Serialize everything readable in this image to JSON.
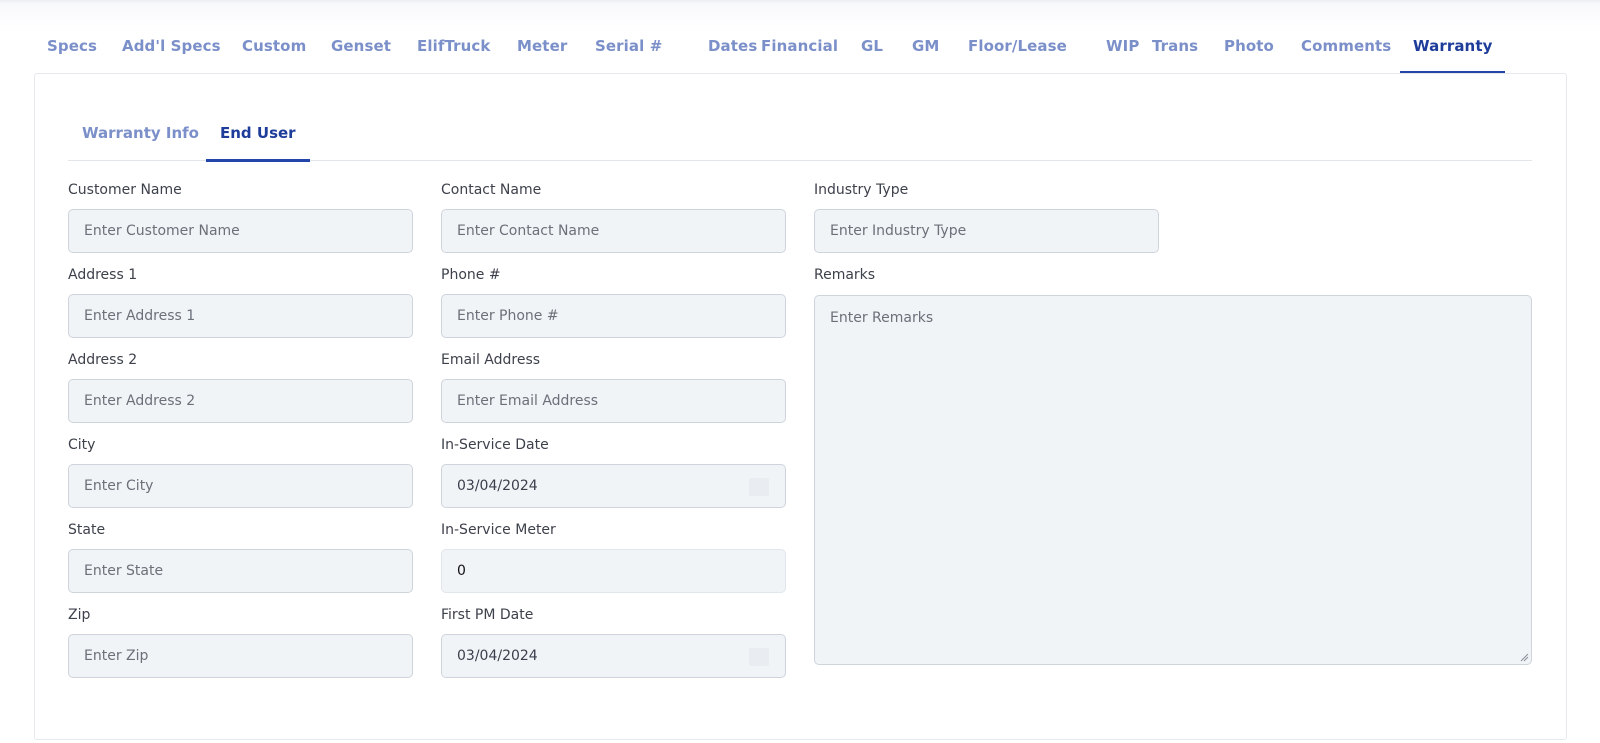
{
  "top_tabs": [
    {
      "label": "Specs"
    },
    {
      "label": "Add'l Specs"
    },
    {
      "label": "Custom"
    },
    {
      "label": "Genset"
    },
    {
      "label": "ElifTruck"
    },
    {
      "label": "Meter"
    },
    {
      "label": "Serial #"
    },
    {
      "label": "Dates"
    },
    {
      "label": "Financial"
    },
    {
      "label": "GL"
    },
    {
      "label": "GM"
    },
    {
      "label": "Floor/Lease"
    },
    {
      "label": "WIP"
    },
    {
      "label": "Trans"
    },
    {
      "label": "Photo"
    },
    {
      "label": "Comments"
    },
    {
      "label": "Warranty"
    }
  ],
  "active_top_tab": "Warranty",
  "sub_tabs": [
    {
      "label": "Warranty Info"
    },
    {
      "label": "End User"
    }
  ],
  "active_sub_tab": "End User",
  "form": {
    "customer_name": {
      "label": "Customer Name",
      "placeholder": "Enter Customer Name"
    },
    "address1": {
      "label": "Address 1",
      "placeholder": "Enter Address 1"
    },
    "address2": {
      "label": "Address 2",
      "placeholder": "Enter Address 2"
    },
    "city": {
      "label": "City",
      "placeholder": "Enter City"
    },
    "state": {
      "label": "State",
      "placeholder": "Enter State"
    },
    "zip": {
      "label": "Zip",
      "placeholder": "Enter Zip"
    },
    "contact_name": {
      "label": "Contact Name",
      "placeholder": "Enter Contact Name"
    },
    "phone": {
      "label": "Phone #",
      "placeholder": "Enter Phone #"
    },
    "email": {
      "label": "Email Address",
      "placeholder": "Enter Email Address"
    },
    "in_service_date": {
      "label": "In-Service Date",
      "value": "03/04/2024"
    },
    "in_service_meter": {
      "label": "In-Service Meter",
      "value": "0"
    },
    "first_pm_date": {
      "label": "First PM Date",
      "value": "03/04/2024"
    },
    "industry_type": {
      "label": "Industry Type",
      "placeholder": "Enter Industry Type"
    },
    "remarks": {
      "label": "Remarks",
      "placeholder": "Enter Remarks"
    }
  },
  "colors": {
    "accent": "#1e3c9a",
    "tab_inactive": "#7b8fc9",
    "input_bg": "#f1f4f7",
    "input_border": "#cfd4dc"
  }
}
